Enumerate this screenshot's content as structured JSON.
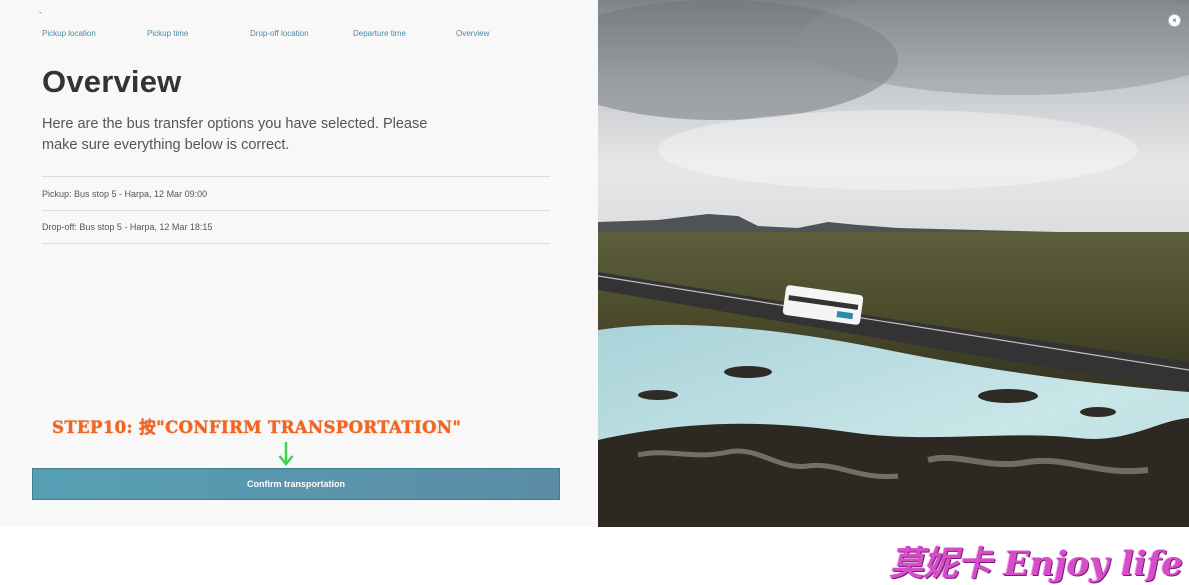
{
  "header": {
    "tiny_mark": "-"
  },
  "steps": [
    {
      "label": "Pickup location"
    },
    {
      "label": "Pickup time"
    },
    {
      "label": "Drop-off location"
    },
    {
      "label": "Departure time"
    },
    {
      "label": "Overview"
    }
  ],
  "overview": {
    "title": "Overview",
    "intro": "Here are the bus transfer options you have selected. Please make sure everything below is correct.",
    "pickup": "Pickup: Bus stop 5 - Harpa, 12 Mar 09:00",
    "dropoff": "Drop-off: Bus stop 5 - Harpa, 12 Mar 18:15"
  },
  "annotation": {
    "text": "STEP10: 按\"CONFIRM TRANSPORTATION\"",
    "color": "#f5631d",
    "arrow_color": "#3bd64a"
  },
  "confirm_button": {
    "label": "Confirm transportation"
  },
  "close_button": {
    "icon": "close-icon"
  },
  "watermark": {
    "text": "莫妮卡 Enjoy life"
  },
  "colors": {
    "accent": "#4a8aa6",
    "button": "#5b98af",
    "watermark": "#d54ec8"
  }
}
